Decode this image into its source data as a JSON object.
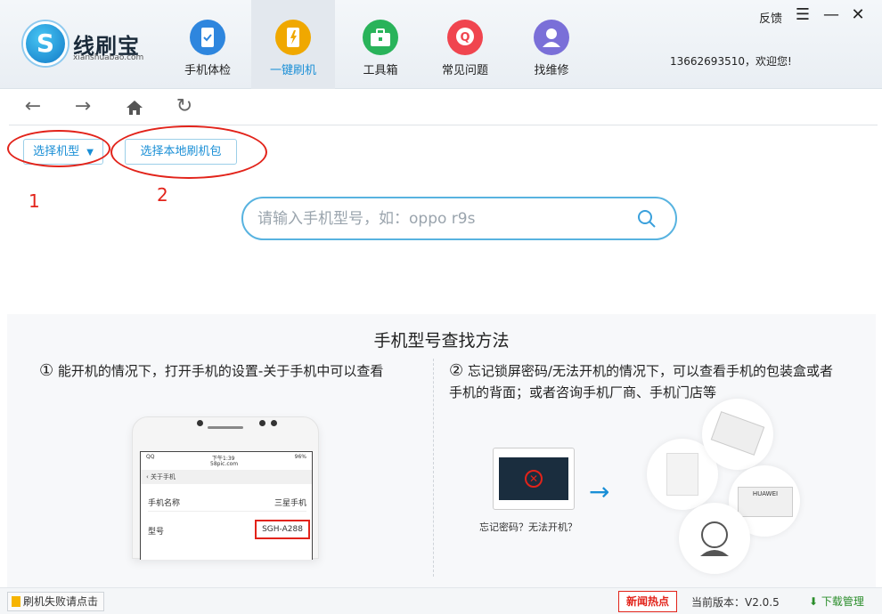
{
  "app": {
    "brand": "线刷宝",
    "brand_sub": "xianshuabao.com"
  },
  "nav": {
    "tabs": [
      {
        "label": "手机体检",
        "icon": "phone-check-icon",
        "color": "#2e86de"
      },
      {
        "label": "一键刷机",
        "icon": "flash-icon",
        "color": "#f0a800"
      },
      {
        "label": "工具箱",
        "icon": "toolbox-icon",
        "color": "#29b35a"
      },
      {
        "label": "常见问题",
        "icon": "faq-icon",
        "color": "#f0454f"
      },
      {
        "label": "找维修",
        "icon": "repair-icon",
        "color": "#7a6fd8"
      }
    ],
    "active_index": 1
  },
  "window": {
    "feedback": "反馈",
    "menu_icon": "menu-icon",
    "min_icon": "minimize-icon",
    "close_icon": "close-icon",
    "user": "13662693510，欢迎您!"
  },
  "toolbar": {
    "back": "back-icon",
    "forward": "forward-icon",
    "home": "home-icon",
    "refresh": "refresh-icon"
  },
  "selectors": {
    "model": "选择机型",
    "local_package": "选择本地刷机包",
    "marker_1": "1",
    "marker_2": "2"
  },
  "search": {
    "placeholder": "请输入手机型号，如：oppo r9s",
    "value": ""
  },
  "help": {
    "title": "手机型号查找方法",
    "method1_num": "①",
    "method1": "能开机的情况下，打开手机的设置-关于手机中可以查看",
    "method2_num": "②",
    "method2": "忘记锁屏密码/无法开机的情况下，可以查看手机的包装盒或者手机的背面；或者咨询手机厂商、手机门店等",
    "phone_status_time": "下午1:39",
    "phone_status_site": "58pic.com",
    "phone_status_left": "QQ",
    "phone_status_right": "96%",
    "phone_header": "关于手机",
    "phone_row1_label": "手机名称",
    "phone_row1_value": "三星手机",
    "phone_row2_label": "型号",
    "phone_row2_value": "SGH-A288",
    "caption": "忘记密码？无法开机？",
    "box_label": "HUAWEI"
  },
  "footer": {
    "fail_link": "刷机失败请点击",
    "news": "新闻热点",
    "version": "当前版本：V2.0.5",
    "download": "下载管理"
  }
}
